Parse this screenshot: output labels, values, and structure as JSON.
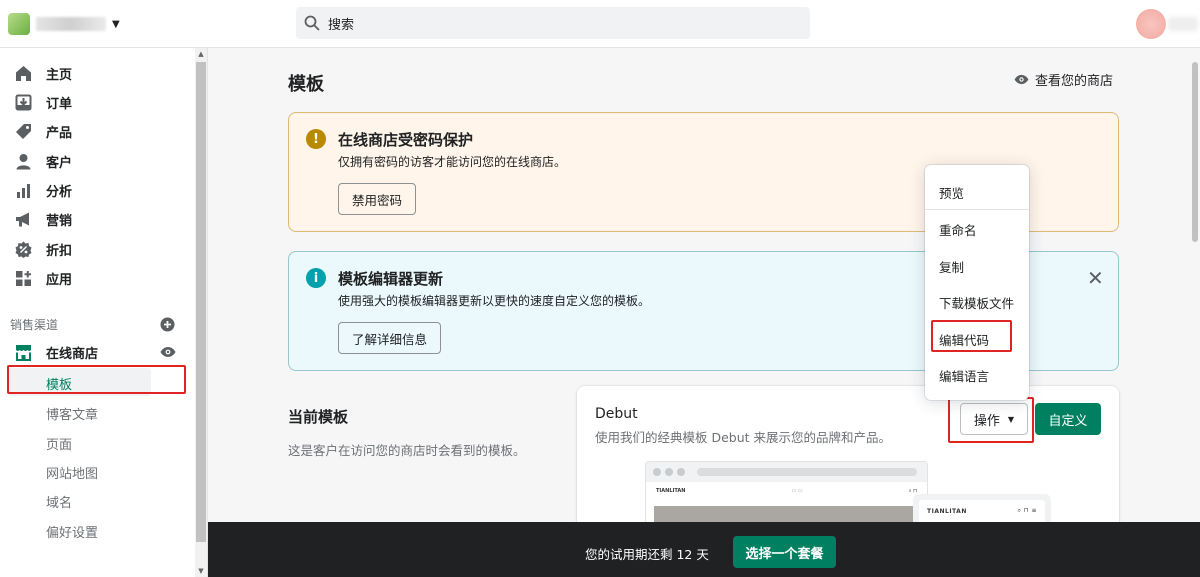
{
  "topbar": {
    "search_placeholder": "搜索"
  },
  "sidebar": {
    "items": [
      {
        "label": "主页",
        "icon": "home-icon"
      },
      {
        "label": "订单",
        "icon": "orders-icon"
      },
      {
        "label": "产品",
        "icon": "tag-icon"
      },
      {
        "label": "客户",
        "icon": "person-icon"
      },
      {
        "label": "分析",
        "icon": "bar-chart-icon"
      },
      {
        "label": "营销",
        "icon": "megaphone-icon"
      },
      {
        "label": "折扣",
        "icon": "discount-icon"
      },
      {
        "label": "应用",
        "icon": "apps-icon"
      }
    ],
    "sales_channels_label": "销售渠道",
    "online_store": "在线商店",
    "sub_items": [
      "模板",
      "博客文章",
      "页面",
      "网站地图",
      "域名",
      "偏好设置"
    ]
  },
  "main": {
    "title": "模板",
    "view_store": "查看您的商店",
    "password_banner": {
      "title": "在线商店受密码保护",
      "body": "仅拥有密码的访客才能访问您的在线商店。",
      "button": "禁用密码"
    },
    "editor_banner": {
      "title": "模板编辑器更新",
      "body": "使用强大的模板编辑器更新以更快的速度自定义您的模板。",
      "button": "了解详细信息"
    },
    "current_theme": {
      "title": "当前模板",
      "description": "这是客户在访问您的商店时会看到的模板。",
      "theme_name": "Debut",
      "theme_description": "使用我们的经典模板 Debut 来展示您的品牌和产品。",
      "actions_label": "操作",
      "customize_label": "自定义",
      "preview_brand": "TIANLITAN"
    },
    "actions_menu": [
      "预览",
      "重命名",
      "复制",
      "下载模板文件",
      "编辑代码",
      "编辑语言"
    ]
  },
  "trial": {
    "text": "您的试用期还剩 12 天",
    "button": "选择一个套餐"
  },
  "colors": {
    "accent": "#008060",
    "warning": "#b98900",
    "info": "#00a0ac",
    "highlight": "#e02424"
  }
}
